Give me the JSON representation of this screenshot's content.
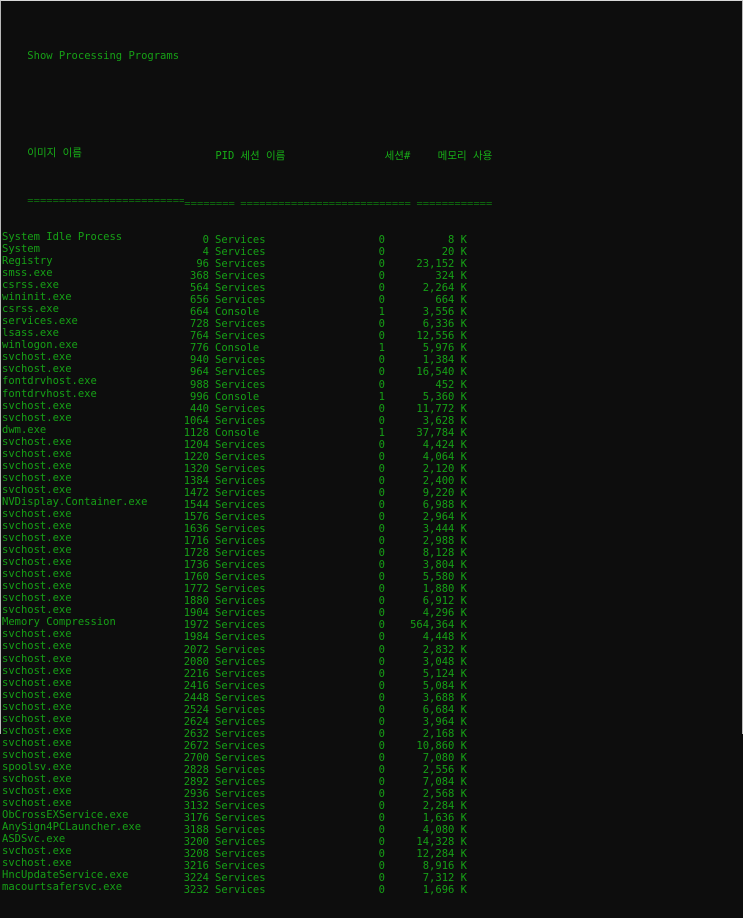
{
  "window": {
    "title_line": "Show Processing Programs",
    "background_color": "#0d0d0d",
    "text_color": "#16a016"
  },
  "table": {
    "headers": {
      "image_name": "이미지 이름",
      "pid": "PID",
      "session_name": "세션 이름",
      "session_num": "세션#",
      "mem_usage": "메모리 사용"
    },
    "separators": {
      "image_name": "=========================",
      "pid": "========",
      "session_name": "================",
      "session_num": "===========",
      "mem_usage": "============"
    },
    "rows": [
      {
        "name": "System Idle Process",
        "pid": "0",
        "session": "Services",
        "num": "0",
        "mem": "8 K"
      },
      {
        "name": "System",
        "pid": "4",
        "session": "Services",
        "num": "0",
        "mem": "20 K"
      },
      {
        "name": "Registry",
        "pid": "96",
        "session": "Services",
        "num": "0",
        "mem": "23,152 K"
      },
      {
        "name": "smss.exe",
        "pid": "368",
        "session": "Services",
        "num": "0",
        "mem": "324 K"
      },
      {
        "name": "csrss.exe",
        "pid": "564",
        "session": "Services",
        "num": "0",
        "mem": "2,264 K"
      },
      {
        "name": "wininit.exe",
        "pid": "656",
        "session": "Services",
        "num": "0",
        "mem": "664 K"
      },
      {
        "name": "csrss.exe",
        "pid": "664",
        "session": "Console",
        "num": "1",
        "mem": "3,556 K"
      },
      {
        "name": "services.exe",
        "pid": "728",
        "session": "Services",
        "num": "0",
        "mem": "6,336 K"
      },
      {
        "name": "lsass.exe",
        "pid": "764",
        "session": "Services",
        "num": "0",
        "mem": "12,556 K"
      },
      {
        "name": "winlogon.exe",
        "pid": "776",
        "session": "Console",
        "num": "1",
        "mem": "5,976 K"
      },
      {
        "name": "svchost.exe",
        "pid": "940",
        "session": "Services",
        "num": "0",
        "mem": "1,384 K"
      },
      {
        "name": "svchost.exe",
        "pid": "964",
        "session": "Services",
        "num": "0",
        "mem": "16,540 K"
      },
      {
        "name": "fontdrvhost.exe",
        "pid": "988",
        "session": "Services",
        "num": "0",
        "mem": "452 K"
      },
      {
        "name": "fontdrvhost.exe",
        "pid": "996",
        "session": "Console",
        "num": "1",
        "mem": "5,360 K"
      },
      {
        "name": "svchost.exe",
        "pid": "440",
        "session": "Services",
        "num": "0",
        "mem": "11,772 K"
      },
      {
        "name": "svchost.exe",
        "pid": "1064",
        "session": "Services",
        "num": "0",
        "mem": "3,628 K"
      },
      {
        "name": "dwm.exe",
        "pid": "1128",
        "session": "Console",
        "num": "1",
        "mem": "37,784 K"
      },
      {
        "name": "svchost.exe",
        "pid": "1204",
        "session": "Services",
        "num": "0",
        "mem": "4,424 K"
      },
      {
        "name": "svchost.exe",
        "pid": "1220",
        "session": "Services",
        "num": "0",
        "mem": "4,064 K"
      },
      {
        "name": "svchost.exe",
        "pid": "1320",
        "session": "Services",
        "num": "0",
        "mem": "2,120 K"
      },
      {
        "name": "svchost.exe",
        "pid": "1384",
        "session": "Services",
        "num": "0",
        "mem": "2,400 K"
      },
      {
        "name": "svchost.exe",
        "pid": "1472",
        "session": "Services",
        "num": "0",
        "mem": "9,220 K"
      },
      {
        "name": "NVDisplay.Container.exe",
        "pid": "1544",
        "session": "Services",
        "num": "0",
        "mem": "6,988 K"
      },
      {
        "name": "svchost.exe",
        "pid": "1576",
        "session": "Services",
        "num": "0",
        "mem": "2,964 K"
      },
      {
        "name": "svchost.exe",
        "pid": "1636",
        "session": "Services",
        "num": "0",
        "mem": "3,444 K"
      },
      {
        "name": "svchost.exe",
        "pid": "1716",
        "session": "Services",
        "num": "0",
        "mem": "2,988 K"
      },
      {
        "name": "svchost.exe",
        "pid": "1728",
        "session": "Services",
        "num": "0",
        "mem": "8,128 K"
      },
      {
        "name": "svchost.exe",
        "pid": "1736",
        "session": "Services",
        "num": "0",
        "mem": "3,804 K"
      },
      {
        "name": "svchost.exe",
        "pid": "1760",
        "session": "Services",
        "num": "0",
        "mem": "5,580 K"
      },
      {
        "name": "svchost.exe",
        "pid": "1772",
        "session": "Services",
        "num": "0",
        "mem": "1,880 K"
      },
      {
        "name": "svchost.exe",
        "pid": "1880",
        "session": "Services",
        "num": "0",
        "mem": "6,912 K"
      },
      {
        "name": "svchost.exe",
        "pid": "1904",
        "session": "Services",
        "num": "0",
        "mem": "4,296 K"
      },
      {
        "name": "Memory Compression",
        "pid": "1972",
        "session": "Services",
        "num": "0",
        "mem": "564,364 K"
      },
      {
        "name": "svchost.exe",
        "pid": "1984",
        "session": "Services",
        "num": "0",
        "mem": "4,448 K"
      },
      {
        "name": "svchost.exe",
        "pid": "2072",
        "session": "Services",
        "num": "0",
        "mem": "2,832 K"
      },
      {
        "name": "svchost.exe",
        "pid": "2080",
        "session": "Services",
        "num": "0",
        "mem": "3,048 K"
      },
      {
        "name": "svchost.exe",
        "pid": "2216",
        "session": "Services",
        "num": "0",
        "mem": "5,124 K"
      },
      {
        "name": "svchost.exe",
        "pid": "2416",
        "session": "Services",
        "num": "0",
        "mem": "5,084 K"
      },
      {
        "name": "svchost.exe",
        "pid": "2448",
        "session": "Services",
        "num": "0",
        "mem": "3,688 K"
      },
      {
        "name": "svchost.exe",
        "pid": "2524",
        "session": "Services",
        "num": "0",
        "mem": "6,684 K"
      },
      {
        "name": "svchost.exe",
        "pid": "2624",
        "session": "Services",
        "num": "0",
        "mem": "3,964 K"
      },
      {
        "name": "svchost.exe",
        "pid": "2632",
        "session": "Services",
        "num": "0",
        "mem": "2,168 K"
      },
      {
        "name": "svchost.exe",
        "pid": "2672",
        "session": "Services",
        "num": "0",
        "mem": "10,860 K"
      },
      {
        "name": "svchost.exe",
        "pid": "2700",
        "session": "Services",
        "num": "0",
        "mem": "7,080 K"
      },
      {
        "name": "spoolsv.exe",
        "pid": "2828",
        "session": "Services",
        "num": "0",
        "mem": "2,556 K"
      },
      {
        "name": "svchost.exe",
        "pid": "2892",
        "session": "Services",
        "num": "0",
        "mem": "7,084 K"
      },
      {
        "name": "svchost.exe",
        "pid": "2936",
        "session": "Services",
        "num": "0",
        "mem": "2,568 K"
      },
      {
        "name": "svchost.exe",
        "pid": "3132",
        "session": "Services",
        "num": "0",
        "mem": "2,284 K"
      },
      {
        "name": "ObCrossEXService.exe",
        "pid": "3176",
        "session": "Services",
        "num": "0",
        "mem": "1,636 K"
      },
      {
        "name": "AnySign4PCLauncher.exe",
        "pid": "3188",
        "session": "Services",
        "num": "0",
        "mem": "4,080 K"
      },
      {
        "name": "ASDSvc.exe",
        "pid": "3200",
        "session": "Services",
        "num": "0",
        "mem": "14,328 K"
      },
      {
        "name": "svchost.exe",
        "pid": "3208",
        "session": "Services",
        "num": "0",
        "mem": "12,284 K"
      },
      {
        "name": "svchost.exe",
        "pid": "3216",
        "session": "Services",
        "num": "0",
        "mem": "8,916 K"
      },
      {
        "name": "HncUpdateService.exe",
        "pid": "3224",
        "session": "Services",
        "num": "0",
        "mem": "7,312 K"
      },
      {
        "name": "macourtsafersvc.exe",
        "pid": "3232",
        "session": "Services",
        "num": "0",
        "mem": "1,696 K"
      }
    ]
  }
}
